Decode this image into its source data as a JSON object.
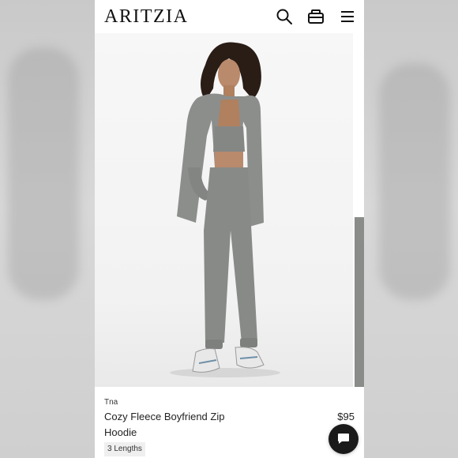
{
  "header": {
    "logo_text": "ARITZIA",
    "icons": {
      "search": "search-icon",
      "bag": "bag-icon",
      "menu": "menu-icon"
    }
  },
  "product": {
    "brand": "Tna",
    "name": "Cozy Fleece Boyfriend Zip Hoodie",
    "price": "$95",
    "lengths_badge": "3 Lengths"
  },
  "chat": {
    "icon": "chat-icon"
  },
  "colors": {
    "page_bg": "#ffffff",
    "photo_bg": "#f4f4f4",
    "fabric_gray": "#8a8c8a",
    "chat_bg": "#1a1a1a"
  }
}
